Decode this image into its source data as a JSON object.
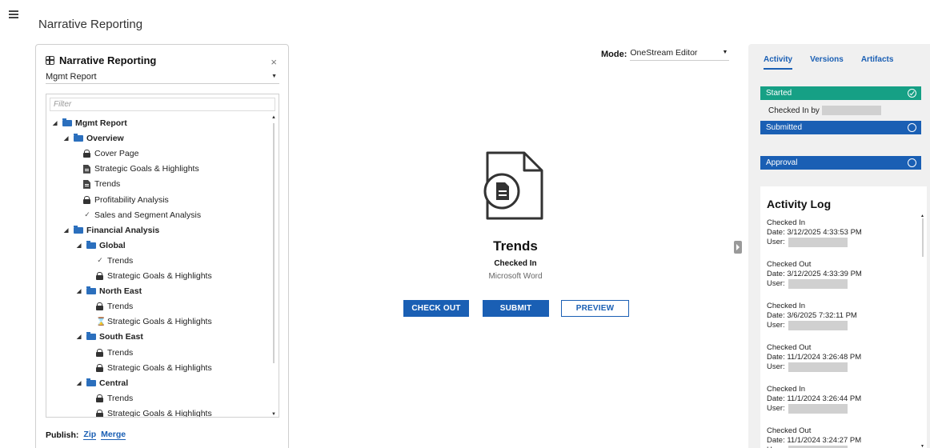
{
  "app": {
    "title": "Narrative Reporting"
  },
  "left_panel": {
    "title": "Narrative Reporting",
    "close_symbol": "×",
    "report_select": "Mgmt Report",
    "filter_placeholder": "Filter",
    "tree": [
      {
        "label": "Mgmt Report",
        "type": "folder",
        "level": 0
      },
      {
        "label": "Overview",
        "type": "folder",
        "level": 1
      },
      {
        "label": "Cover Page",
        "type": "lock",
        "level": 2
      },
      {
        "label": "Strategic Goals & Highlights",
        "type": "doc",
        "level": 2
      },
      {
        "label": "Trends",
        "type": "doc",
        "level": 2
      },
      {
        "label": "Profitability Analysis",
        "type": "lock",
        "level": 2
      },
      {
        "label": "Sales and Segment Analysis",
        "type": "check",
        "level": 2
      },
      {
        "label": "Financial Analysis",
        "type": "folder",
        "level": 1
      },
      {
        "label": "Global",
        "type": "folder",
        "level": 2
      },
      {
        "label": "Trends",
        "type": "check",
        "level": 3
      },
      {
        "label": "Strategic Goals & Highlights",
        "type": "lock",
        "level": 3
      },
      {
        "label": "North East",
        "type": "folder",
        "level": 2
      },
      {
        "label": "Trends",
        "type": "lock",
        "level": 3
      },
      {
        "label": "Strategic Goals & Highlights",
        "type": "hourglass",
        "level": 3
      },
      {
        "label": "South East",
        "type": "folder",
        "level": 2
      },
      {
        "label": "Trends",
        "type": "lock",
        "level": 3
      },
      {
        "label": "Strategic Goals & Highlights",
        "type": "lock",
        "level": 3
      },
      {
        "label": "Central",
        "type": "folder",
        "level": 2
      },
      {
        "label": "Trends",
        "type": "lock",
        "level": 3
      },
      {
        "label": "Strategic Goals & Highlights",
        "type": "lock",
        "level": 3
      }
    ],
    "publish": {
      "label": "Publish:",
      "zip": "Zip",
      "merge": "Merge"
    }
  },
  "center": {
    "mode_label": "Mode:",
    "mode_value": "OneStream Editor",
    "document_name": "Trends",
    "document_status": "Checked In",
    "document_type": "Microsoft Word",
    "buttons": {
      "check_out": "CHECK OUT",
      "submit": "SUBMIT",
      "preview": "PREVIEW"
    }
  },
  "right_panel": {
    "tabs": [
      "Activity",
      "Versions",
      "Artifacts"
    ],
    "active_tab": "Activity",
    "stages": [
      {
        "label": "Started",
        "color": "#16a085",
        "done": true
      },
      {
        "label": "Submitted",
        "color": "#1a5fb4",
        "done": false
      },
      {
        "label": "Approval",
        "color": "#1a5fb4",
        "done": false
      }
    ],
    "checked_in_by_label": "Checked In by",
    "activity_log": {
      "title": "Activity Log",
      "user_label": "User:",
      "entries": [
        {
          "action": "Checked In",
          "date": "Date: 3/12/2025 4:33:53 PM"
        },
        {
          "action": "Checked Out",
          "date": "Date: 3/12/2025 4:33:39 PM"
        },
        {
          "action": "Checked In",
          "date": "Date: 3/6/2025 7:32:11 PM"
        },
        {
          "action": "Checked Out",
          "date": "Date: 11/1/2024 3:26:48 PM"
        },
        {
          "action": "Checked In",
          "date": "Date: 11/1/2024 3:26:44 PM"
        },
        {
          "action": "Checked Out",
          "date": "Date: 11/1/2024 3:24:27 PM"
        }
      ]
    }
  }
}
